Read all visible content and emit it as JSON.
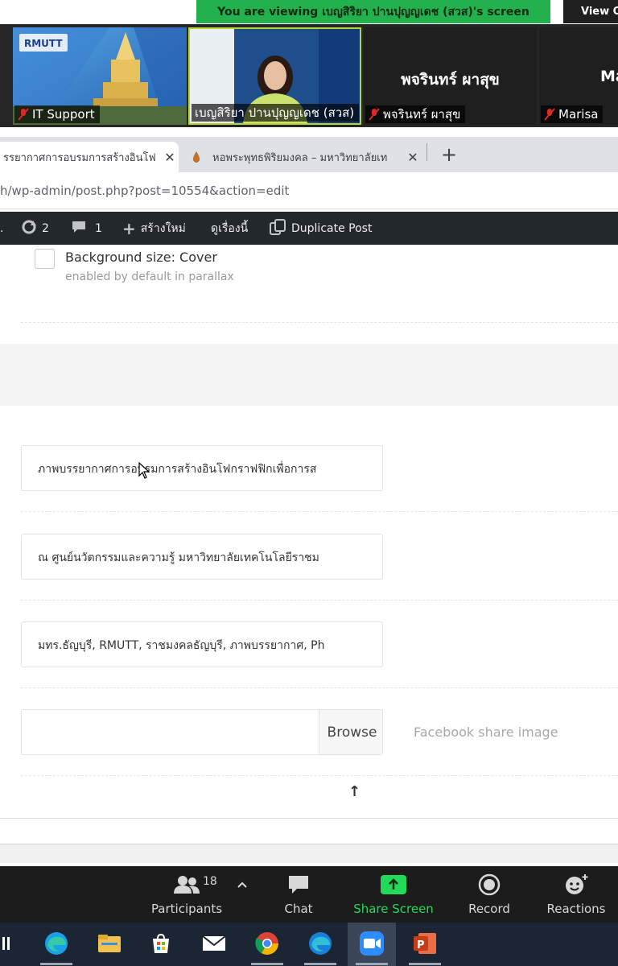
{
  "zoom": {
    "share_banner": "You are viewing เบญสิริยา ปานปุญญเดช (สวส)'s screen",
    "view_options": "View O",
    "participants": [
      {
        "name": "IT Support"
      },
      {
        "name": "เบญสิริยา ปานปุญญเดช (สวส)"
      },
      {
        "name": "พจรินทร์ ผาสุข",
        "big_name": "พจรินทร์ ผาสุข"
      },
      {
        "name": "Marisa",
        "big_name": "Ma"
      }
    ],
    "toolbar": {
      "participants_label": "Participants",
      "participants_count": "18",
      "chat_label": "Chat",
      "share_label": "Share Screen",
      "record_label": "Record",
      "reactions_label": "Reactions"
    }
  },
  "browser": {
    "tabs": [
      {
        "title": "รรยากาศการอบรมการสร้างอินโฟ"
      },
      {
        "title": "หอพระพุทธพิริยมงคล – มหาวิทยาลัยเท"
      }
    ],
    "url": "h/wp-admin/post.php?post=10554&action=edit"
  },
  "adminbar": {
    "updates_count": "2",
    "comments_count": "1",
    "new_label": "สร้างใหม่",
    "view_label": "ดูเรื่องนี้",
    "duplicate_label": "Duplicate Post"
  },
  "form": {
    "bg_size_label": "Background size: Cover",
    "bg_size_desc": "enabled by default in parallax",
    "title_value": "ภาพบรรยากาศการอบรมการสร้างอินโฟกราฟฟิกเพื่อการส",
    "desc_value": "ณ ศูนย์นวัตกรรมและความรู้ มหาวิทยาลัยเทคโนโลยีราชม",
    "keywords_value": "มทร.ธัญบุรี, RMUTT, ราชมงคลธัญบุรี, ภาพบรรยากาศ, Ph",
    "browse_label": "Browse",
    "fb_image_label": "Facebook share image",
    "up_arrow": "↑"
  },
  "colors": {
    "share_green": "#22b14c",
    "zoom_share_icon": "#23d959",
    "wp_admin_bar": "#23282d"
  }
}
